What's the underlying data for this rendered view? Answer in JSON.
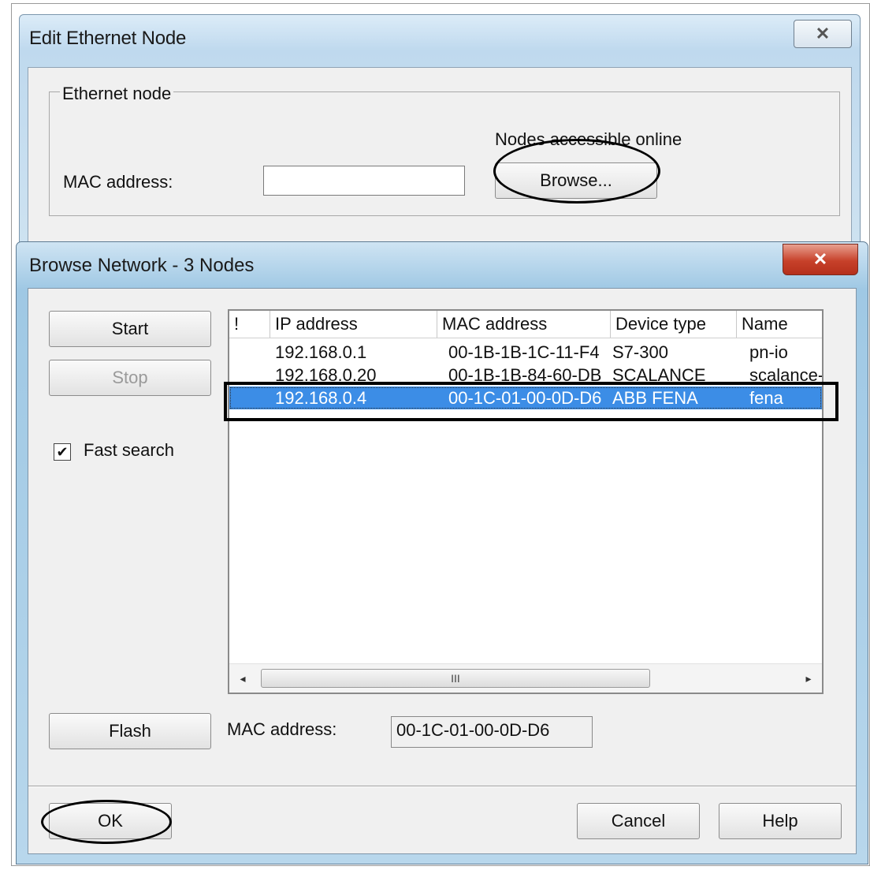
{
  "edit_dialog": {
    "title": "Edit Ethernet Node",
    "close_glyph": "✕",
    "group_label": "Ethernet node",
    "online_label": "Nodes accessible online",
    "mac_label": "MAC address:",
    "mac_value": "",
    "browse_label": "Browse..."
  },
  "browse_dialog": {
    "title": "Browse Network - 3 Nodes",
    "close_glyph": "✕",
    "start_label": "Start",
    "stop_label": "Stop",
    "fast_search_label": "Fast search",
    "fast_search_checked": true,
    "check_glyph": "✔",
    "columns": [
      "!",
      "IP address",
      "MAC address",
      "Device type",
      "Name"
    ],
    "rows": [
      {
        "ip": "192.168.0.1",
        "mac": "00-1B-1B-1C-11-F4",
        "type": "S7-300",
        "name": "pn-io",
        "selected": false
      },
      {
        "ip": "192.168.0.20",
        "mac": "00-1B-1B-84-60-DB",
        "type": "SCALANCE",
        "name": "scalance-",
        "selected": false
      },
      {
        "ip": "192.168.0.4",
        "mac": "00-1C-01-00-0D-D6",
        "type": "ABB FENA",
        "name": "fena",
        "selected": true
      }
    ],
    "scroll_left": "◂",
    "scroll_right": "▸",
    "scroll_grip": "III",
    "flash_label": "Flash",
    "mac_label": "MAC address:",
    "mac_value": "00-1C-01-00-0D-D6",
    "ok_label": "OK",
    "cancel_label": "Cancel",
    "help_label": "Help"
  },
  "colors": {
    "selection": "#3c8de6",
    "annotation": "#000000",
    "close_red": "#c7412a"
  }
}
